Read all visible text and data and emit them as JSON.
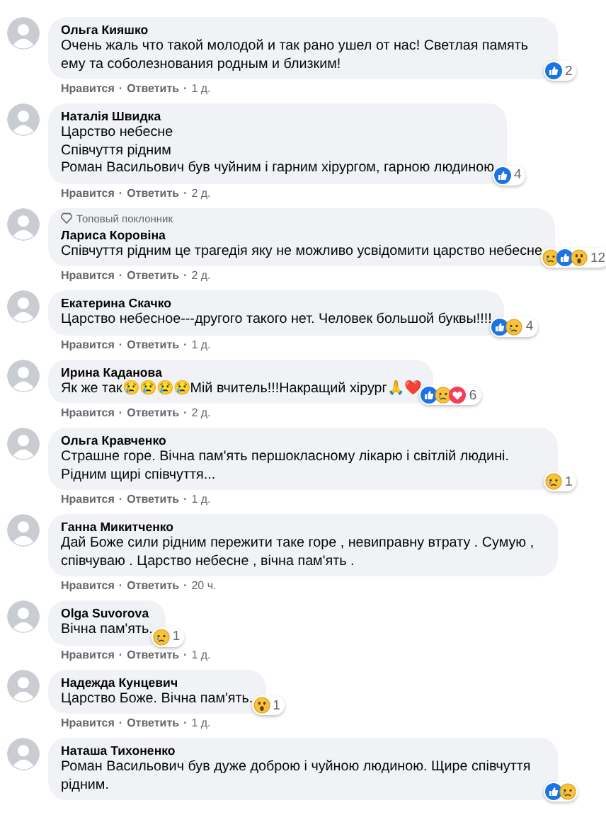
{
  "comments": [
    {
      "author": "Ольга Кияшко",
      "lines": [
        "Очень жаль что такой молодой и так рано ушел от нас! Светлая память ему та соболезнования родным и близким!"
      ],
      "actions": [
        {
          "kind": "link",
          "text": "Нравится"
        },
        {
          "kind": "dot",
          "text": "·"
        },
        {
          "kind": "link",
          "text": "Ответить"
        },
        {
          "kind": "dot",
          "text": "·"
        },
        {
          "kind": "time",
          "text": "1 д."
        }
      ],
      "reactions": {
        "icons": [
          {
            "kind": "like"
          }
        ],
        "count": "2"
      }
    },
    {
      "author": "Наталія Швидка",
      "lines": [
        "Царство небесне",
        "Співчуття рідним",
        "Роман Васильович був чуйним і гарним хірургом, гарною людиною"
      ],
      "actions": [
        {
          "kind": "link",
          "text": "Нравится"
        },
        {
          "kind": "dot",
          "text": "·"
        },
        {
          "kind": "link",
          "text": "Ответить"
        },
        {
          "kind": "dot",
          "text": "·"
        },
        {
          "kind": "time",
          "text": "2 д."
        }
      ],
      "reactions": {
        "icons": [
          {
            "kind": "like"
          }
        ],
        "count": "4"
      }
    },
    {
      "badge": "Топовый поклонник",
      "author": "Лариса Коровіна",
      "lines": [
        "Співчуття рідним це трагедія яку не можливо усвідомити царство небесне"
      ],
      "actions": [
        {
          "kind": "link",
          "text": "Нравится"
        },
        {
          "kind": "dot",
          "text": "·"
        },
        {
          "kind": "link",
          "text": "Ответить"
        },
        {
          "kind": "dot",
          "text": "·"
        },
        {
          "kind": "time",
          "text": "2 д."
        }
      ],
      "reactions": {
        "icons": [
          {
            "kind": "sad"
          },
          {
            "kind": "like"
          },
          {
            "kind": "wow"
          }
        ],
        "count": "12"
      }
    },
    {
      "author": "Екатерина Скачко",
      "lines": [
        "Царство небесное---другого такого нет. Человек большой буквы!!!!"
      ],
      "actions": [
        {
          "kind": "link",
          "text": "Нравится"
        },
        {
          "kind": "dot",
          "text": "·"
        },
        {
          "kind": "link",
          "text": "Ответить"
        },
        {
          "kind": "dot",
          "text": "·"
        },
        {
          "kind": "time",
          "text": "1 д."
        }
      ],
      "reactions": {
        "icons": [
          {
            "kind": "like"
          },
          {
            "kind": "sad"
          }
        ],
        "count": "4"
      }
    },
    {
      "author": "Ирина Каданова",
      "lines": [
        "Як же так😢😢😢😢Мій вчитель!!!Накращий хірург🙏❤️"
      ],
      "actions": [
        {
          "kind": "link",
          "text": "Нравится"
        },
        {
          "kind": "dot",
          "text": "·"
        },
        {
          "kind": "link",
          "text": "Ответить"
        },
        {
          "kind": "dot",
          "text": "·"
        },
        {
          "kind": "time",
          "text": "2 д."
        }
      ],
      "reactions": {
        "icons": [
          {
            "kind": "like"
          },
          {
            "kind": "sad"
          },
          {
            "kind": "love"
          }
        ],
        "count": "6"
      }
    },
    {
      "author": "Ольга Кравченко",
      "lines": [
        "Страшне горе. Вічна пам'ять першокласному лікарю і світлій людині. Рідним щирі співчуття..."
      ],
      "actions": [
        {
          "kind": "link",
          "text": "Нравится"
        },
        {
          "kind": "dot",
          "text": "·"
        },
        {
          "kind": "link",
          "text": "Ответить"
        },
        {
          "kind": "dot",
          "text": "·"
        },
        {
          "kind": "time",
          "text": "1 д."
        }
      ],
      "reactions": {
        "icons": [
          {
            "kind": "sad"
          }
        ],
        "count": "1"
      }
    },
    {
      "author": "Ганна Микитченко",
      "lines": [
        "Дай Боже сили рідним пережити таке горе , невиправну втрату . Сумую , співчуваю . Царство небесне , вічна пам'ять ."
      ],
      "actions": [
        {
          "kind": "link",
          "text": "Нравится"
        },
        {
          "kind": "dot",
          "text": "·"
        },
        {
          "kind": "link",
          "text": "Ответить"
        },
        {
          "kind": "dot",
          "text": "·"
        },
        {
          "kind": "time",
          "text": "20 ч."
        }
      ]
    },
    {
      "author": "Olga Suvorova",
      "lines": [
        "Вічна пам'ять."
      ],
      "actions": [
        {
          "kind": "link",
          "text": "Нравится"
        },
        {
          "kind": "dot",
          "text": "·"
        },
        {
          "kind": "link",
          "text": "Ответить"
        },
        {
          "kind": "dot",
          "text": "·"
        },
        {
          "kind": "time",
          "text": "1 д."
        }
      ],
      "reactions": {
        "icons": [
          {
            "kind": "sad"
          }
        ],
        "count": "1"
      }
    },
    {
      "author": "Надежда Кунцевич",
      "lines": [
        "Царство Боже. Вічна пам'ять."
      ],
      "actions": [
        {
          "kind": "link",
          "text": "Нравится"
        },
        {
          "kind": "dot",
          "text": "·"
        },
        {
          "kind": "link",
          "text": "Ответить"
        },
        {
          "kind": "dot",
          "text": "·"
        },
        {
          "kind": "time",
          "text": "1 д."
        }
      ],
      "reactions": {
        "icons": [
          {
            "kind": "wow"
          }
        ],
        "count": "1"
      }
    },
    {
      "author": "Наташа Тихоненко",
      "lines": [
        "Роман Васильович був дуже доброю і чуйною людиною. Щире співчуття рідним."
      ],
      "reactions": {
        "icons": [
          {
            "kind": "like"
          },
          {
            "kind": "sad"
          }
        ]
      }
    }
  ]
}
